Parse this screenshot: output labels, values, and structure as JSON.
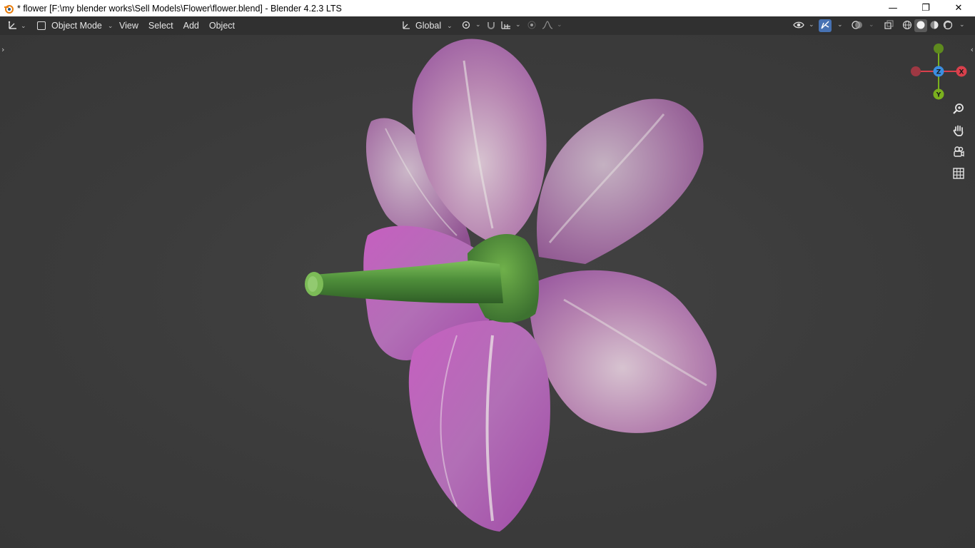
{
  "window": {
    "title": "* flower [F:\\my blender works\\Sell Models\\Flower\\flower.blend] - Blender 4.2.3 LTS",
    "minimize_glyph": "—",
    "restore_glyph": "❐",
    "close_glyph": "✕"
  },
  "header": {
    "editor_type_icon": "axis-icon",
    "mode_label": "Object Mode",
    "menus": [
      "View",
      "Select",
      "Add",
      "Object"
    ],
    "transform_orientation": "Global"
  },
  "viewport": {
    "gizmo_axes": {
      "x": "X",
      "y": "Y",
      "z": "Z"
    },
    "colors": {
      "x_axis": "#d9404c",
      "y_axis": "#7ab01e",
      "z_axis": "#3b8ee0",
      "active_blue": "#4772b3"
    },
    "object": "flower-model"
  }
}
